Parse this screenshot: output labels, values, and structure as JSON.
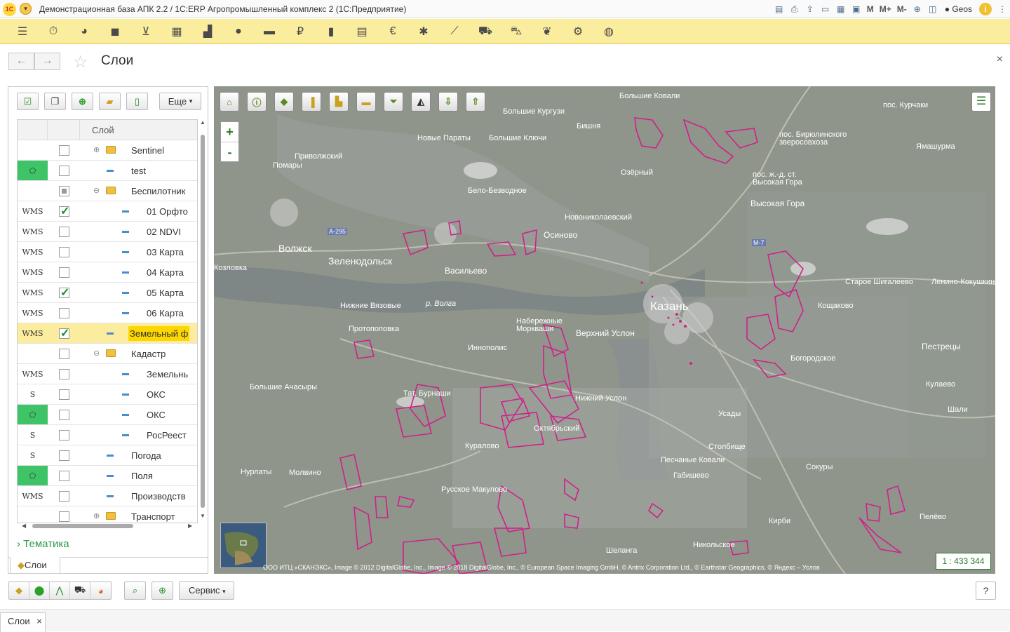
{
  "window": {
    "title": "Демонстрационная база АПК 2.2 / 1С:ERP Агропромышленный комплекс 2  (1С:Предприятие)",
    "logo": "1С",
    "user": "Geos",
    "toolbar_text": [
      "M",
      "M+",
      "M-"
    ]
  },
  "form": {
    "title": "Слои",
    "back_icon": "arrow-left-icon",
    "forward_icon": "arrow-right-icon"
  },
  "layers_panel": {
    "more_label": "Еще",
    "column_header": "Слой",
    "thematic_label": "Тематика",
    "tab_label": "Слои",
    "rows": [
      {
        "name": "Sentinel",
        "type": "",
        "checked": "off",
        "kind": "folder",
        "expander": "⊕",
        "level": 0
      },
      {
        "name": "test",
        "type": "polygon",
        "checked": "off",
        "kind": "layer",
        "level": 0
      },
      {
        "name": "Беспилотник",
        "type": "",
        "checked": "partial",
        "kind": "folder",
        "expander": "⊖",
        "level": 0
      },
      {
        "name": "01 Орфто",
        "type": "WMS",
        "checked": "on",
        "kind": "layer",
        "level": 1
      },
      {
        "name": "02 NDVI",
        "type": "WMS",
        "checked": "off",
        "kind": "layer",
        "level": 1
      },
      {
        "name": "03 Карта",
        "type": "WMS",
        "checked": "off",
        "kind": "layer",
        "level": 1
      },
      {
        "name": "04 Карта",
        "type": "WMS",
        "checked": "off",
        "kind": "layer",
        "level": 1
      },
      {
        "name": "05 Карта",
        "type": "WMS",
        "checked": "on",
        "kind": "layer",
        "level": 1
      },
      {
        "name": "06 Карта",
        "type": "WMS",
        "checked": "off",
        "kind": "layer",
        "level": 1
      },
      {
        "name": "Земельный ф",
        "type": "WMS",
        "checked": "on",
        "kind": "layer",
        "level": 0,
        "selected": true
      },
      {
        "name": "Кадастр",
        "type": "",
        "checked": "off",
        "kind": "folder",
        "expander": "⊖",
        "level": 0
      },
      {
        "name": "Земельнь",
        "type": "WMS",
        "checked": "off",
        "kind": "layer",
        "level": 1
      },
      {
        "name": "ОКС",
        "type": "S",
        "checked": "off",
        "kind": "layer",
        "level": 1
      },
      {
        "name": "ОКС",
        "type": "polygon",
        "checked": "off",
        "kind": "layer",
        "level": 1
      },
      {
        "name": "РосРеест",
        "type": "S",
        "checked": "off",
        "kind": "layer",
        "level": 1
      },
      {
        "name": "Погода",
        "type": "S",
        "checked": "off",
        "kind": "layer",
        "level": 0
      },
      {
        "name": "Поля",
        "type": "polygon",
        "checked": "off",
        "kind": "layer",
        "level": 0
      },
      {
        "name": "Производств",
        "type": "WMS",
        "checked": "off",
        "kind": "layer",
        "level": 0
      },
      {
        "name": "Транспорт",
        "type": "",
        "checked": "off",
        "kind": "folder",
        "expander": "⊕",
        "level": 0
      }
    ]
  },
  "map": {
    "scale": "1 : 433 344",
    "copyright": "ООО ИТЦ «СКАНЭКС», Image © 2012 DigitalGlobe, Inc., Image © 2018 DigitalGlobe, Inc., © European Space Imaging GmbH, © Antrix Corporation Ltd., © Earthstar Geographics, © Яндекс – Услов",
    "field_color": "#d0208a",
    "labels": [
      "Большие Ковали",
      "Большие Кургузи",
      "Бишня",
      "Новые Параты",
      "Большие Ключи",
      "Приволжский",
      "Помары",
      "Озёрный",
      "Бело-Безводное",
      "Новониколаевский",
      "Осиново",
      "Волжск",
      "Зеленодольск",
      "Васильево",
      "Козловка",
      "р. Волга",
      "Нижние Вязовые",
      "Протопоповка",
      "Казань",
      "Верхний Услон",
      "Набережные Моркваши",
      "Иннополис",
      "Большие Ачасыры",
      "Нижний Услон",
      "Октябрьский",
      "Куралово",
      "Нурлаты",
      "Молвино",
      "Русское Макулово",
      "Столбище",
      "Песчаные Ковали",
      "Габишево",
      "Сокуры",
      "Кирби",
      "Никольское",
      "Шеланга",
      "Высокая Гора",
      "пос. ж.-д. ст. Высокая Гора",
      "пос. Бирюлинского зверосовхоза",
      "Ямашурма",
      "пос. Курчаки",
      "Старое Шигалеево",
      "Ленино-Кокушкино",
      "Кощаково",
      "Пестрецы",
      "Богородское",
      "Кулаево",
      "Шали",
      "Пелёво",
      "Усады",
      "Тат. Бурнаши",
      "А-295",
      "М-7"
    ]
  },
  "bottom": {
    "service_label": "Сервис",
    "help_label": "?"
  },
  "wintab": {
    "label": "Слои"
  }
}
